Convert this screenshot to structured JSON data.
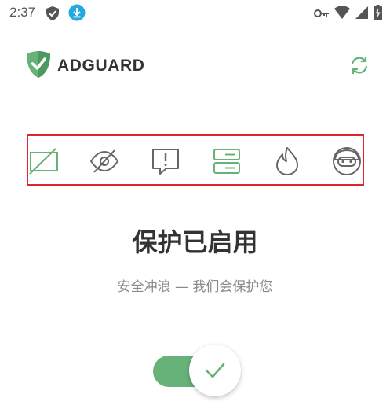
{
  "status_bar": {
    "time": "2:37",
    "left_icons": [
      "shield-icon",
      "download-icon"
    ],
    "right_icons": [
      "vpn-key-icon",
      "wifi-icon",
      "cellular-icon",
      "battery-charging-icon"
    ]
  },
  "header": {
    "app_name": "ADGUARD",
    "logo_icon": "adguard-shield-icon",
    "action_icon": "refresh-icon"
  },
  "features": [
    {
      "icon": "ad-blocking-icon"
    },
    {
      "icon": "tracking-protection-icon"
    },
    {
      "icon": "annoyances-icon"
    },
    {
      "icon": "dns-servers-icon"
    },
    {
      "icon": "firewall-icon"
    },
    {
      "icon": "stealth-mode-icon"
    }
  ],
  "protection": {
    "title": "保护已启用",
    "subtitle": "安全冲浪 — 我们会保护您",
    "enabled": true
  },
  "colors": {
    "brand_green": "#67b279",
    "icon_gray": "#666666",
    "highlight_border": "#e0252b"
  }
}
